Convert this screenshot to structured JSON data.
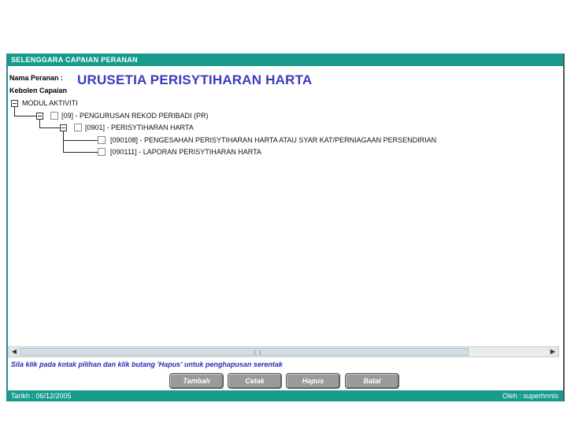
{
  "header": {
    "title": "SELENGGARA CAPAIAN PERANAN"
  },
  "form": {
    "role_label": "Nama Peranan :",
    "role_value": "URUSETIA PERISYTIHARAN HARTA",
    "access_label": "Kebolen Capaian"
  },
  "tree": {
    "root": "MODUL AKTIVITI",
    "level1": "[09] - PENGURUSAN REKOD PERIBADI (PR)",
    "level2": "[0901] - PERISYTIHARAN HARTA",
    "leaves": [
      "[090108] - PENGESAHAN PERISYTIHARAN HARTA ATAU SYAR KAT/PERNIAGAAN PERSENDIRIAN",
      "[090111] - LAPORAN PERISYTIHARAN HARTA"
    ]
  },
  "instruction": "Sila klik pada kotak pilihan dan klik butang 'Hapus' untuk penghapusan serentak",
  "buttons": {
    "tambah": "Tambah",
    "cetak": "Cetak",
    "hapus": "Hapus",
    "batal": "Batal"
  },
  "footer": {
    "date": "Tarikh : 06/12/2005",
    "user": "Oleh : superhrmis"
  },
  "colors": {
    "teal": "#159c8c",
    "role_text": "#3b3bbf",
    "button": "#9a9a9a"
  }
}
